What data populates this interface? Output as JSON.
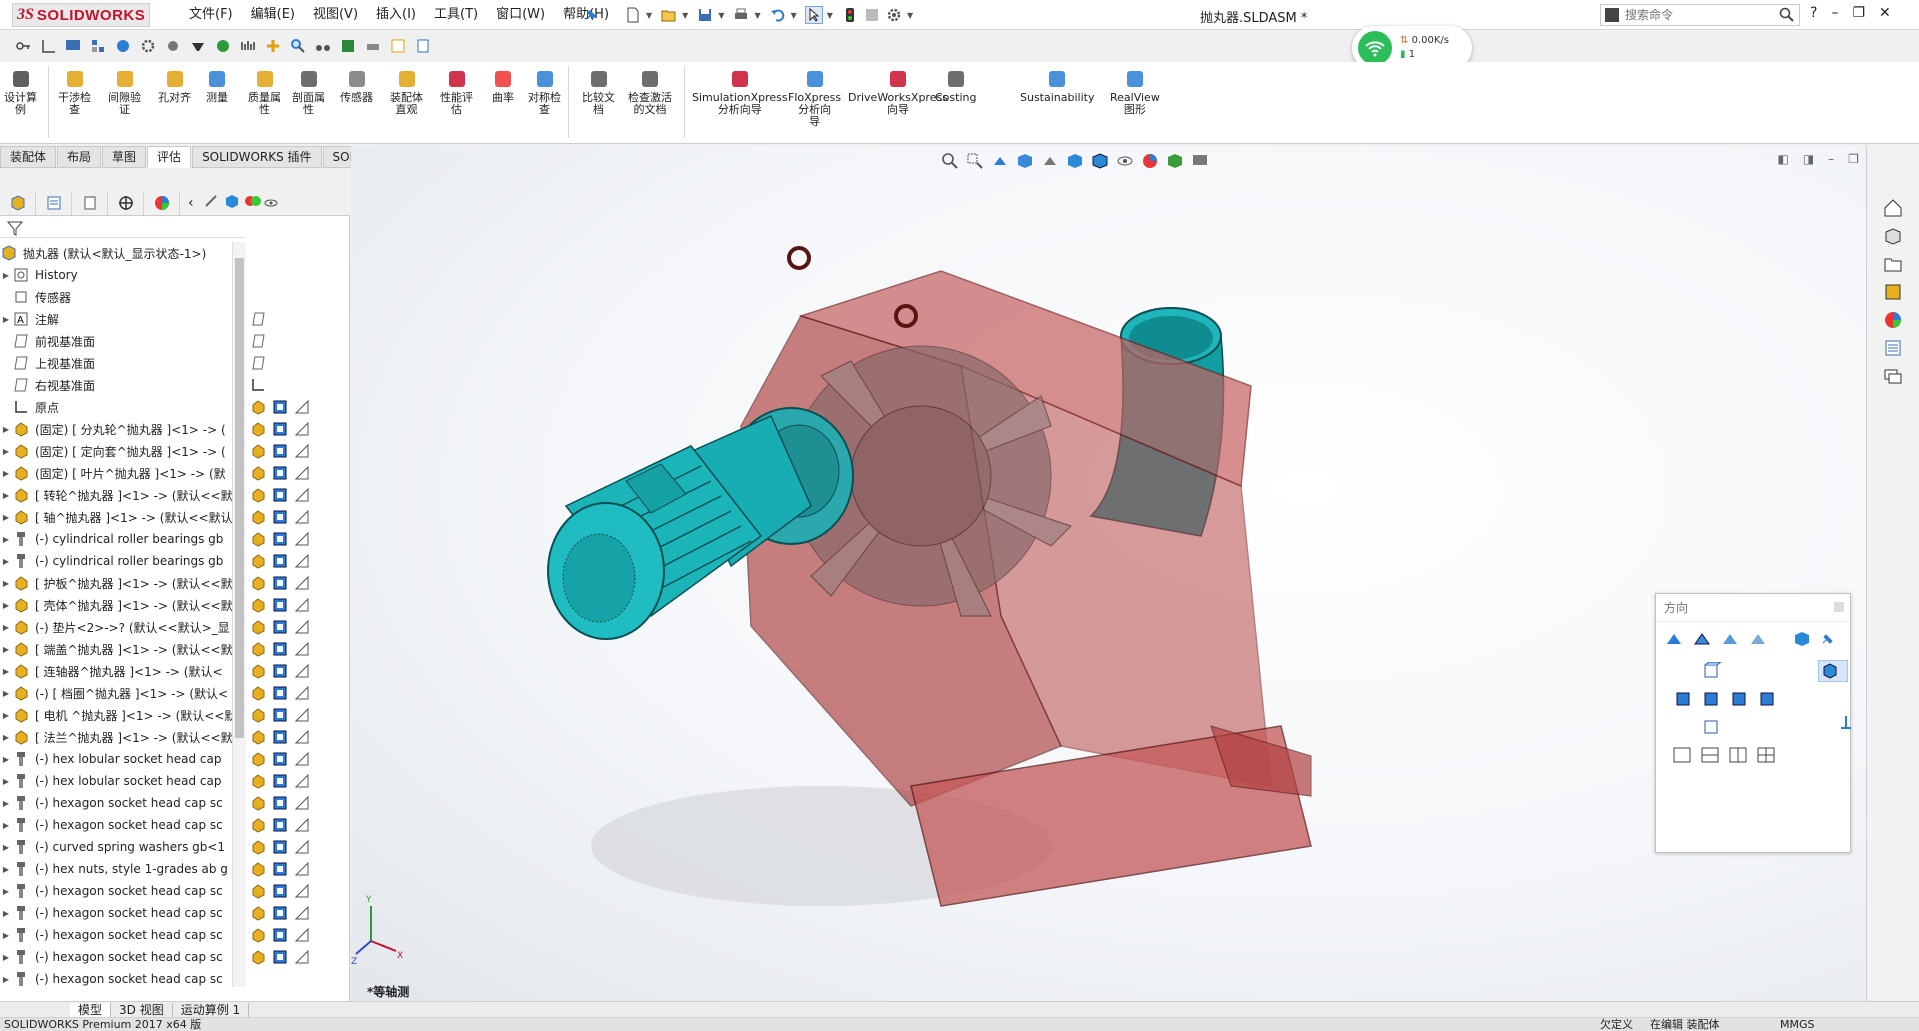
{
  "app": {
    "logo_ds": "3S",
    "logo_text": "SOLIDWORKS",
    "doc_title": "抛丸器.SLDASM *"
  },
  "menus": [
    "文件(F)",
    "编辑(E)",
    "视图(V)",
    "插入(I)",
    "工具(T)",
    "窗口(W)",
    "帮助(H)"
  ],
  "search": {
    "placeholder": "搜索命令"
  },
  "network": {
    "speed": "0.00K/s",
    "count": "1"
  },
  "commands": [
    {
      "label": "设计算\n例",
      "icon": "design-study-icon"
    },
    {
      "label": "干涉检\n查",
      "icon": "interference-icon"
    },
    {
      "label": "间隙验\n证",
      "icon": "clearance-icon"
    },
    {
      "label": "孔对齐",
      "icon": "hole-align-icon"
    },
    {
      "label": "测量",
      "icon": "measure-icon"
    },
    {
      "label": "质量属\n性",
      "icon": "mass-props-icon"
    },
    {
      "label": "剖面属\n性",
      "icon": "section-props-icon"
    },
    {
      "label": "传感器",
      "icon": "sensor-icon"
    },
    {
      "label": "装配体\n直观",
      "icon": "assembly-visual-icon"
    },
    {
      "label": "性能评\n估",
      "icon": "performance-icon"
    },
    {
      "label": "曲率",
      "icon": "curvature-icon"
    },
    {
      "label": "对称检\n查",
      "icon": "symmetry-icon"
    },
    {
      "label": "比较文\n档",
      "icon": "compare-icon"
    },
    {
      "label": "检查激活\n的文档",
      "icon": "check-doc-icon"
    },
    {
      "label": "SimulationXpress\n分析向导",
      "icon": "simxpress-icon"
    },
    {
      "label": "FloXpress\n分析向\n导",
      "icon": "floxpress-icon"
    },
    {
      "label": "DriveWorksXpress\n向导",
      "icon": "driveworks-icon"
    },
    {
      "label": "Costing",
      "icon": "costing-icon"
    },
    {
      "label": "Sustainability",
      "icon": "sustainability-icon"
    },
    {
      "label": "RealView\n图形",
      "icon": "realview-icon"
    }
  ],
  "tabs": [
    {
      "label": "装配体",
      "active": false
    },
    {
      "label": "布局",
      "active": false
    },
    {
      "label": "草图",
      "active": false
    },
    {
      "label": "评估",
      "active": true
    },
    {
      "label": "SOLIDWORKS 插件",
      "active": false
    },
    {
      "label": "SOLIDWORKS MBD",
      "active": false
    }
  ],
  "tree": {
    "root": "抛丸器 (默认<默认_显示状态-1>)",
    "rows": [
      {
        "label": "History",
        "type": "history",
        "arrow": true
      },
      {
        "label": "传感器",
        "type": "sensor",
        "arrow": false
      },
      {
        "label": "注解",
        "type": "annotation",
        "arrow": true
      },
      {
        "label": "前视基准面",
        "type": "plane",
        "arrow": false
      },
      {
        "label": "上视基准面",
        "type": "plane",
        "arrow": false
      },
      {
        "label": "右视基准面",
        "type": "plane",
        "arrow": false
      },
      {
        "label": "原点",
        "type": "origin",
        "arrow": false
      },
      {
        "label": "(固定) [ 分丸轮^抛丸器 ]<1> -> (",
        "type": "part",
        "arrow": true
      },
      {
        "label": "(固定) [ 定向套^抛丸器 ]<1> -> (",
        "type": "part",
        "arrow": true
      },
      {
        "label": "(固定) [ 叶片^抛丸器 ]<1> -> (默",
        "type": "part",
        "arrow": true
      },
      {
        "label": "[ 转轮^抛丸器 ]<1> -> (默认<<默",
        "type": "part",
        "arrow": true
      },
      {
        "label": "[ 轴^抛丸器 ]<1> -> (默认<<默认",
        "type": "part",
        "arrow": true
      },
      {
        "label": "(-) cylindrical roller bearings gb",
        "type": "toolbox",
        "arrow": true
      },
      {
        "label": "(-) cylindrical roller bearings gb",
        "type": "toolbox",
        "arrow": true
      },
      {
        "label": "[ 护板^抛丸器 ]<1> -> (默认<<默",
        "type": "part",
        "arrow": true
      },
      {
        "label": "[ 壳体^抛丸器 ]<1> -> (默认<<默",
        "type": "part",
        "arrow": true
      },
      {
        "label": "(-) 垫片<2>->? (默认<<默认>_显",
        "type": "part",
        "arrow": true
      },
      {
        "label": "[ 端盖^抛丸器 ]<1> -> (默认<<默",
        "type": "part",
        "arrow": true
      },
      {
        "label": "[ 连轴器^抛丸器 ]<1> -> (默认<",
        "type": "part",
        "arrow": true
      },
      {
        "label": "(-) [ 档圈^抛丸器 ]<1> -> (默认<",
        "type": "part",
        "arrow": true
      },
      {
        "label": "[ 电机 ^抛丸器 ]<1> -> (默认<<默",
        "type": "part",
        "arrow": true
      },
      {
        "label": "[ 法兰^抛丸器 ]<1> -> (默认<<默",
        "type": "part",
        "arrow": true
      },
      {
        "label": "(-) hex lobular socket head cap",
        "type": "toolbox",
        "arrow": true
      },
      {
        "label": "(-) hex lobular socket head cap",
        "type": "toolbox",
        "arrow": true
      },
      {
        "label": "(-) hexagon socket head cap sc",
        "type": "toolbox",
        "arrow": true
      },
      {
        "label": "(-) hexagon socket head cap sc",
        "type": "toolbox",
        "arrow": true
      },
      {
        "label": "(-) curved spring washers gb<1",
        "type": "toolbox",
        "arrow": true
      },
      {
        "label": "(-) hex nuts, style 1-grades ab g",
        "type": "toolbox",
        "arrow": true
      },
      {
        "label": "(-) hexagon socket head cap sc",
        "type": "toolbox",
        "arrow": true
      },
      {
        "label": "(-) hexagon socket head cap sc",
        "type": "toolbox",
        "arrow": true
      },
      {
        "label": "(-) hexagon socket head cap sc",
        "type": "toolbox",
        "arrow": true
      },
      {
        "label": "(-) hexagon socket head cap sc",
        "type": "toolbox",
        "arrow": true
      },
      {
        "label": "(-) hexagon socket head cap sc",
        "type": "toolbox",
        "arrow": true
      }
    ]
  },
  "viewport": {
    "view_name": "*等轴测"
  },
  "orientation": {
    "title": "方向"
  },
  "bottom_tabs": [
    {
      "label": "模型",
      "active": true
    },
    {
      "label": "3D 视图",
      "active": false
    },
    {
      "label": "运动算例 1",
      "active": false
    }
  ],
  "status": {
    "left": "SOLIDWORKS Premium 2017 x64 版",
    "state": "欠定义",
    "mode": "在编辑 装配体",
    "units": "MMGS"
  },
  "colors": {
    "accent": "#c8102e",
    "housing": "#a8262a",
    "motor": "#19b3b8",
    "selection": "#2b7cd3"
  }
}
